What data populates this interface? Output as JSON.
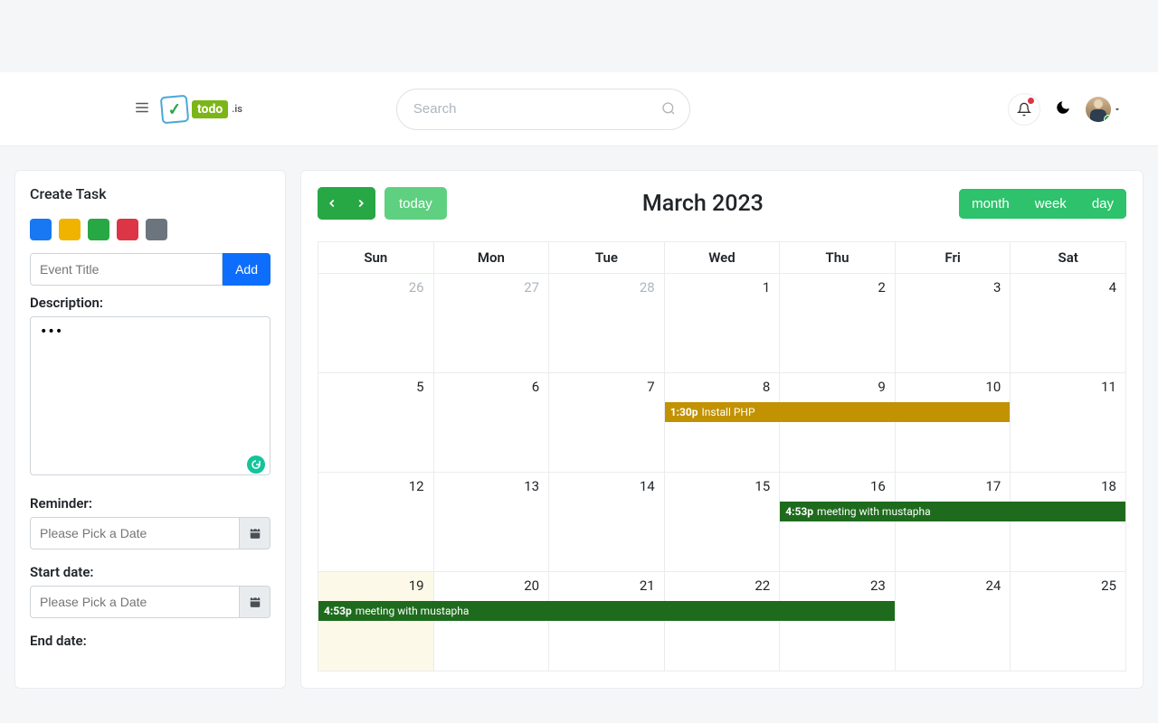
{
  "header": {
    "logo_text": "todo",
    "logo_sub": ".is",
    "search_placeholder": "Search"
  },
  "sidebar": {
    "title": "Create Task",
    "colors": [
      "#1877f2",
      "#f0b400",
      "#28a745",
      "#dc3545",
      "#6c757d"
    ],
    "event_title_placeholder": "Event Title",
    "add_btn": "Add",
    "description_label": "Description:",
    "description_value": "•••",
    "reminder_label": "Reminder:",
    "startdate_label": "Start date:",
    "enddate_label": "End date:",
    "date_placeholder": "Please Pick a Date"
  },
  "calendar": {
    "title": "March 2023",
    "today_btn": "today",
    "views": {
      "month": "month",
      "week": "week",
      "day": "day"
    },
    "weekdays": [
      "Sun",
      "Mon",
      "Tue",
      "Wed",
      "Thu",
      "Fri",
      "Sat"
    ],
    "grid": [
      [
        {
          "n": "26",
          "other": true
        },
        {
          "n": "27",
          "other": true
        },
        {
          "n": "28",
          "other": true
        },
        {
          "n": "1"
        },
        {
          "n": "2"
        },
        {
          "n": "3"
        },
        {
          "n": "4"
        }
      ],
      [
        {
          "n": "5"
        },
        {
          "n": "6"
        },
        {
          "n": "7"
        },
        {
          "n": "8"
        },
        {
          "n": "9"
        },
        {
          "n": "10"
        },
        {
          "n": "11"
        }
      ],
      [
        {
          "n": "12"
        },
        {
          "n": "13"
        },
        {
          "n": "14"
        },
        {
          "n": "15"
        },
        {
          "n": "16"
        },
        {
          "n": "17"
        },
        {
          "n": "18"
        }
      ],
      [
        {
          "n": "19",
          "today": true
        },
        {
          "n": "20"
        },
        {
          "n": "21"
        },
        {
          "n": "22"
        },
        {
          "n": "23"
        },
        {
          "n": "24"
        },
        {
          "n": "25"
        }
      ]
    ],
    "events": [
      {
        "row": 1,
        "startCol": 3,
        "span": 3,
        "time": "1:30p",
        "title": "Install PHP",
        "color": "#c29203"
      },
      {
        "row": 2,
        "startCol": 4,
        "span": 3,
        "time": "4:53p",
        "title": "meeting with mustapha",
        "color": "#1e6b1e"
      },
      {
        "row": 3,
        "startCol": 0,
        "span": 5,
        "time": "4:53p",
        "title": "meeting with mustapha",
        "color": "#1e6b1e"
      }
    ]
  }
}
